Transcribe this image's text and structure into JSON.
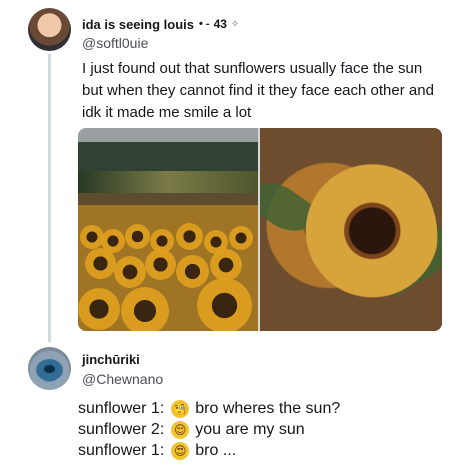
{
  "tweet": {
    "author": {
      "display_name": "ida is seeing louis",
      "name_symbols": "• -",
      "name_number": "43",
      "name_icon": "sparkle-icon",
      "handle": "@softl0uie"
    },
    "text_lines": [
      "I just found out that sunflowers usually face the sun",
      "but when they cannot find it they face each other and",
      "idk it made me smile a lot"
    ],
    "media": {
      "left_image": "sunflower-field-photo",
      "right_image": "sunflower-closeup-photo"
    }
  },
  "reply": {
    "author": {
      "display_name": "jinchūriki",
      "handle": "@Chewnano"
    },
    "lines": [
      {
        "speaker": "sunflower 1:",
        "emoji": "monocle-face-emoji",
        "emoji_glyph": "🧐",
        "text": "bro wheres the sun?"
      },
      {
        "speaker": "sunflower 2:",
        "emoji": "relieved-face-emoji",
        "emoji_glyph": "😌",
        "text": "you are my sun"
      },
      {
        "speaker": "sunflower 1:",
        "emoji": "heart-eyes-face-emoji",
        "emoji_glyph": "😍",
        "text": "bro ..."
      }
    ]
  },
  "colors": {
    "text": "#14171a",
    "secondary_text": "#4b4f56",
    "thread_line": "#cfd9de",
    "sunflower_yellow": "#e1a11e"
  }
}
